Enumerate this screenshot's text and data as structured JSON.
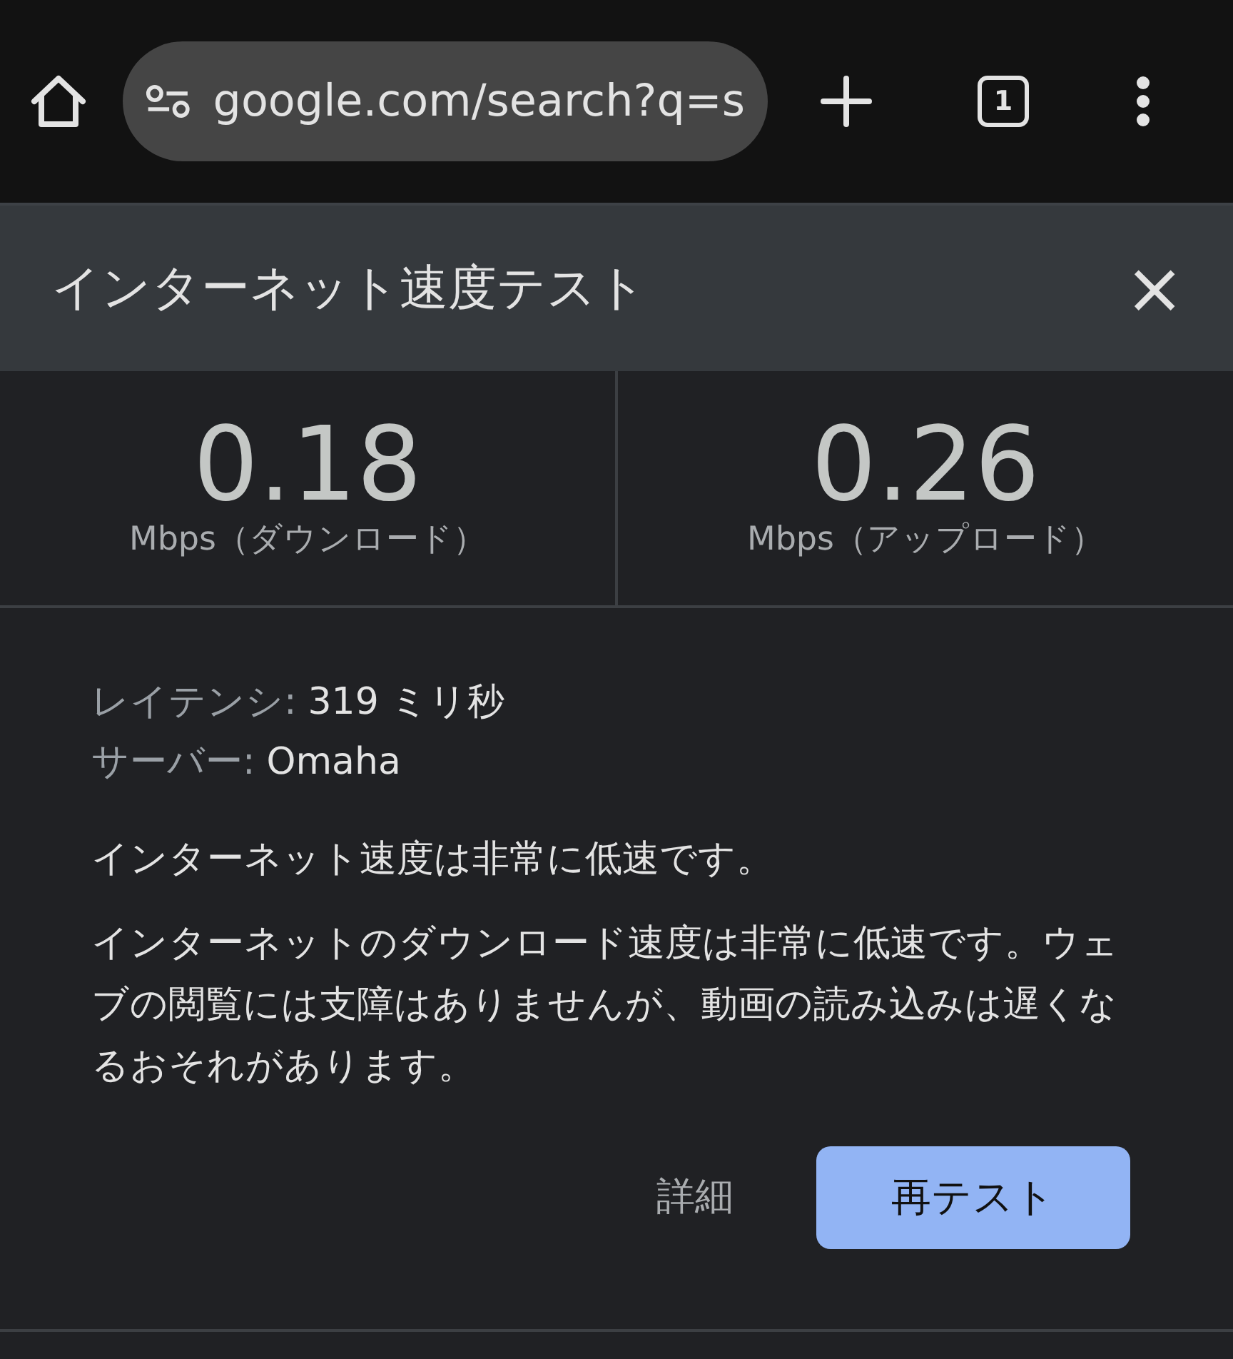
{
  "browser_bar": {
    "url": "google.com/search?q=s",
    "tab_count": "1"
  },
  "panel": {
    "title": "インターネット速度テスト",
    "close": "×"
  },
  "speeds": [
    {
      "value": "0.18",
      "unit": "Mbps（ダウンロード）"
    },
    {
      "value": "0.26",
      "unit": "Mbps（アップロード）"
    }
  ],
  "details": [
    {
      "label": "レイテンシ:",
      "value": "319 ミリ秒"
    },
    {
      "label": "サーバー:",
      "value": "Omaha"
    }
  ],
  "summary": "インターネット速度は非常に低速です。",
  "description": "インターネットのダウンロード速度は非常に低速です。ウェブの閲覧には支障はありませんが、動画の読み込みは遅くなるおそれがあります。",
  "buttons": [
    {
      "label": "詳細",
      "kind": "text"
    },
    {
      "label": "再テスト",
      "kind": "filled"
    }
  ]
}
